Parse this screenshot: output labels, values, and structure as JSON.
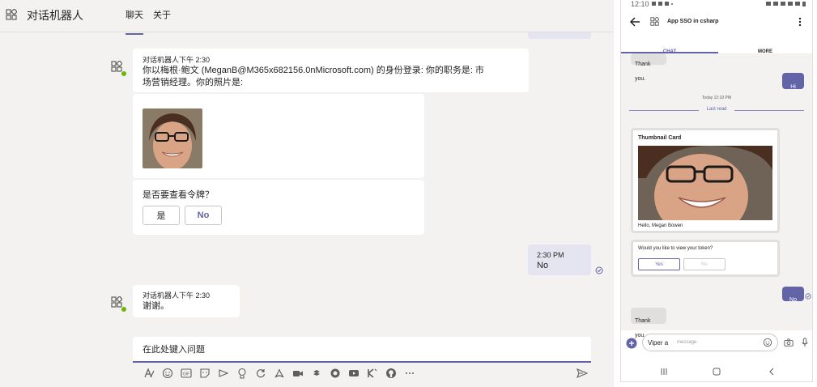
{
  "colors": {
    "accent": "#6264a7",
    "sent_bubble": "#e5e5f1",
    "online": "#6bb700"
  },
  "desktop": {
    "header": {
      "title": "对话机器人",
      "tabs": [
        "聊天",
        "关于"
      ]
    },
    "messages": [
      {
        "sender_time": "对话机器人下午 2:30",
        "text": "你以梅根·鲍文 (MeganB@M365x682156.0nMicrosoft.com) 的身份登录: 你的职务是: 市场营销经理。你的照片是:"
      },
      {
        "card_question": "是否要查看令牌？",
        "buttons": [
          "是",
          "No"
        ]
      },
      {
        "sent_time": "2:30 PM",
        "sent_text": "No"
      },
      {
        "sender_time": "对话机器人下午 2:30",
        "text": "谢谢。"
      }
    ],
    "compose": {
      "placeholder": "在此处键入问题"
    },
    "toolbar_icons": [
      "format-icon",
      "emoji-icon",
      "gif-icon",
      "sticker-icon",
      "meet-icon",
      "praise-icon",
      "loop-icon",
      "acrobat-icon",
      "video-icon",
      "stream-icon",
      "approvals-icon",
      "youtube-icon",
      "klout-icon",
      "github-icon",
      "more-icon",
      "send-icon"
    ]
  },
  "phone": {
    "status": {
      "time": "12:10"
    },
    "header": {
      "title": "App SSO in csharp"
    },
    "tabs": [
      "CHAT",
      "MORE"
    ],
    "messages": {
      "thank_you_top": "Thank you.",
      "hi": "Hi",
      "timestamp": "Today 12:10 PM",
      "last_read": "Last read",
      "card_title": "Thumbnail Card",
      "card_caption": "Hello, Megan Bowen",
      "question": "Would you like to view your token?",
      "buttons": [
        "Yes",
        "No"
      ],
      "no": "No",
      "thank_you_bottom": "Thank you."
    },
    "compose": {
      "typed": "Viper a",
      "placeholder": "message"
    }
  }
}
